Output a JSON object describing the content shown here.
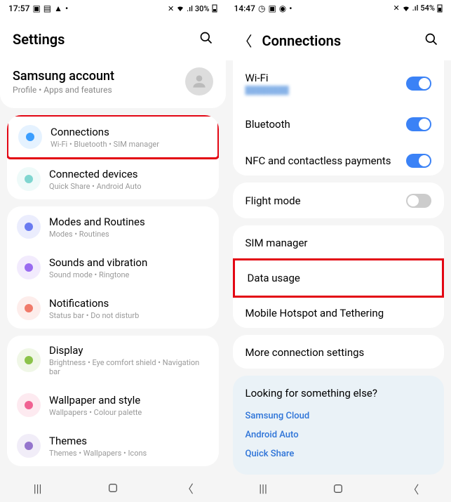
{
  "left": {
    "status": {
      "time": "17:57",
      "battery": "30%"
    },
    "header": {
      "title": "Settings"
    },
    "account": {
      "title": "Samsung account",
      "sub": "Profile  •  Apps and features"
    },
    "groups": [
      [
        {
          "title": "Connections",
          "sub": "Wi-Fi  •  Bluetooth  •  SIM manager",
          "icon_color": "#3b9eff",
          "highlight": true
        },
        {
          "title": "Connected devices",
          "sub": "Quick Share  •  Android Auto",
          "icon_color": "#7fd6d0"
        }
      ],
      [
        {
          "title": "Modes and Routines",
          "sub": "Modes  •  Routines",
          "icon_color": "#6a7bf0"
        },
        {
          "title": "Sounds and vibration",
          "sub": "Sound mode  •  Ringtone",
          "icon_color": "#9a6cf0"
        },
        {
          "title": "Notifications",
          "sub": "Status bar  •  Do not disturb",
          "icon_color": "#f07a6a"
        }
      ],
      [
        {
          "title": "Display",
          "sub": "Brightness  •  Eye comfort shield  •  Navigation bar",
          "icon_color": "#8bc34a"
        },
        {
          "title": "Wallpaper and style",
          "sub": "Wallpapers  •  Colour palette",
          "icon_color": "#f06292"
        },
        {
          "title": "Themes",
          "sub": "Themes  •  Wallpapers  •  Icons",
          "icon_color": "#9575cd"
        }
      ]
    ]
  },
  "right": {
    "status": {
      "time": "14:47",
      "battery": "54%"
    },
    "header": {
      "title": "Connections"
    },
    "toggles": [
      {
        "title": "Wi-Fi",
        "sub": "blurred",
        "on": true
      },
      {
        "title": "Bluetooth",
        "on": true
      },
      {
        "title": "NFC and contactless payments",
        "on": true
      }
    ],
    "flight": {
      "title": "Flight mode",
      "on": false
    },
    "items": [
      {
        "title": "SIM manager"
      },
      {
        "title": "Data usage",
        "highlight": true
      },
      {
        "title": "Mobile Hotspot and Tethering"
      }
    ],
    "more": {
      "title": "More connection settings"
    },
    "lookfor": {
      "head": "Looking for something else?",
      "links": [
        "Samsung Cloud",
        "Android Auto",
        "Quick Share"
      ]
    }
  }
}
